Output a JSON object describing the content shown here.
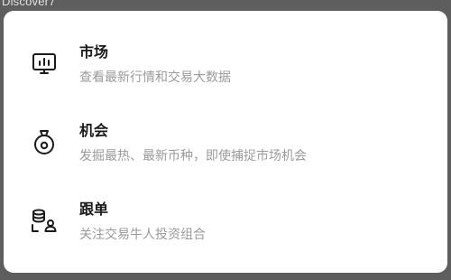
{
  "backdrop": {
    "title": "Discover7"
  },
  "menu": {
    "items": [
      {
        "icon": "market-chart-icon",
        "title": "市场",
        "description": "查看最新行情和交易大数据"
      },
      {
        "icon": "opportunity-bag-icon",
        "title": "机会",
        "description": "发掘最热、最新币种，即使捕捉市场机会"
      },
      {
        "icon": "copy-trading-icon",
        "title": "跟单",
        "description": "关注交易牛人投资组合"
      }
    ]
  },
  "colors": {
    "backdrop": "#5e5e5e",
    "sheet": "#ffffff",
    "title_text": "#1a1a1a",
    "description_text": "#9a9a9a"
  }
}
